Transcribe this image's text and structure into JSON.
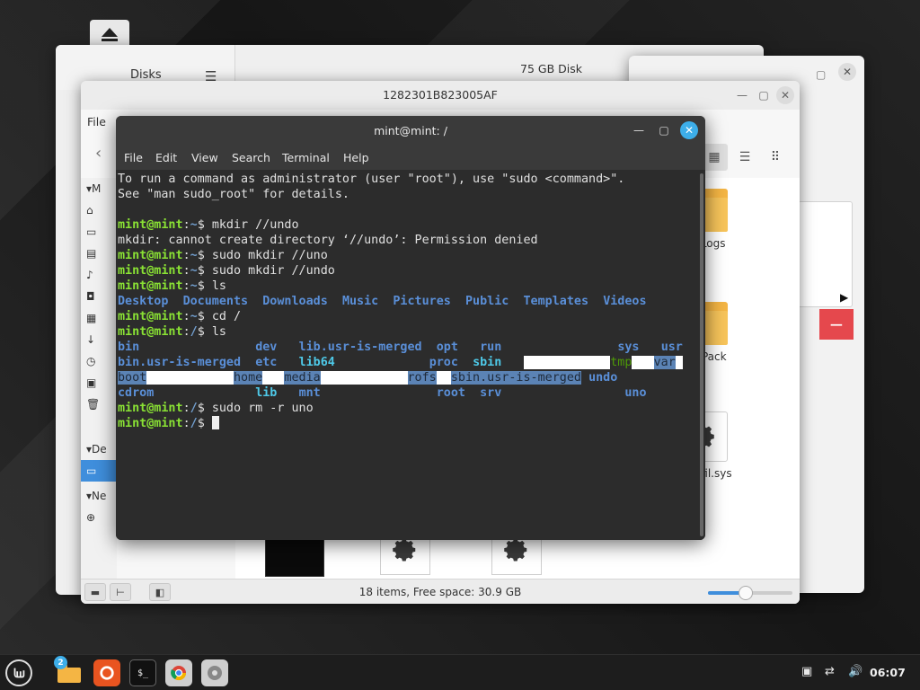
{
  "disks": {
    "title": "Disks",
    "menu_icon": "hamburger-icon",
    "main_title": "75 GB Disk"
  },
  "file_manager": {
    "title": "1282301B823005AF",
    "menu_file": "File",
    "sidebar_letters": [
      "M",
      "De",
      "Ne"
    ],
    "items": [
      {
        "label": "PerfLogs",
        "icon": "folder-icon"
      },
      {
        "label": "SkinPack",
        "icon": "folder-icon"
      },
      {
        "label": "hiberfil.sys",
        "icon": "gear-icon"
      }
    ],
    "status_text": "18 items, Free space: 30.9 GB",
    "zoom_level": 0.45
  },
  "terminal": {
    "title": "mint@mint: /",
    "menu": [
      "File",
      "Edit",
      "View",
      "Search",
      "Terminal",
      "Help"
    ],
    "prompt_user": "mint@mint",
    "lines": {
      "l1": "To run a command as administrator (user \"root\"), use \"sudo <command>\".",
      "l2": "See \"man sudo_root\" for details.",
      "cmd1": "mkdir //undo",
      "err1": "mkdir: cannot create directory ‘//undo’: Permission denied",
      "cmd2": "sudo mkdir //uno",
      "cmd3": "sudo mkdir //undo",
      "cmd4": "ls",
      "cmd5": "cd /",
      "cmd6": "ls",
      "cmd7": "sudo rm -r uno"
    },
    "home_ls": [
      "Desktop",
      "Documents",
      "Downloads",
      "Music",
      "Pictures",
      "Public",
      "Templates",
      "Videos"
    ],
    "root_ls": {
      "r1": [
        "bin",
        "dev",
        "lib.usr-is-merged",
        "opt",
        "run",
        "sys",
        "usr"
      ],
      "r2": [
        "bin.usr-is-merged",
        "etc",
        "lib64",
        "proc",
        "sbin",
        "tmp",
        "var"
      ],
      "r3": [
        "boot",
        "home",
        "media",
        "rofs",
        "sbin.usr-is-merged",
        "undo"
      ],
      "r4": [
        "cdrom",
        "lib",
        "mnt",
        "root",
        "srv",
        "uno"
      ]
    }
  },
  "taskbar": {
    "badge_count": "2",
    "clock": "06:07"
  },
  "colors": {
    "accent": "#3daee9",
    "prompt_green": "#8ae234",
    "dir_blue": "#5a8fd8",
    "folder": "#f4b544",
    "delete_red": "#e5484d"
  }
}
